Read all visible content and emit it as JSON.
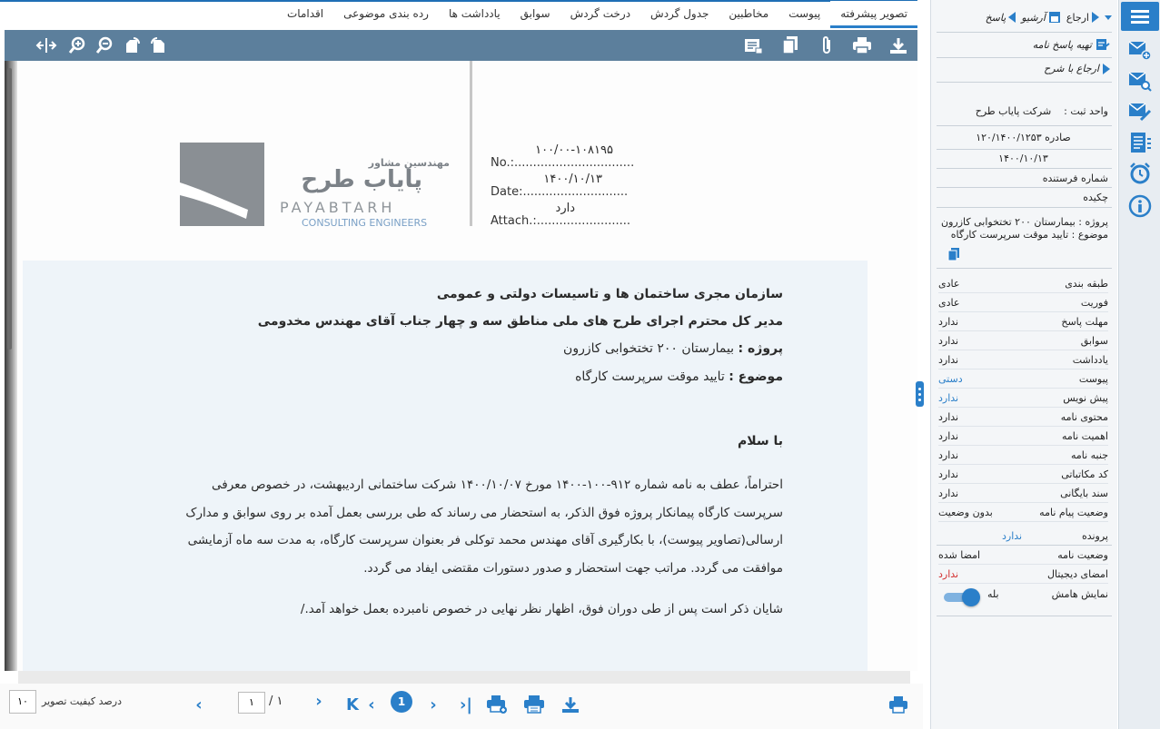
{
  "tabs": [
    "تصویر پیشرفته",
    "پیوست",
    "مخاطبین",
    "جدول گردش",
    "درخت گردش",
    "سوابق",
    "یادداشت ها",
    "رده بندی موضوعی",
    "اقدامات"
  ],
  "panel": {
    "actions": {
      "refer": "ارجاع",
      "archive": "آرشیو",
      "reply": "پاسخ"
    },
    "prepare_reply": "تهیه پاسخ نامه",
    "refer_with_note": "ارجاع با شرح",
    "register_unit_label": "واحد ثبت :",
    "register_unit_value": "شرکت پایاب طرح",
    "issued_label": "صادره",
    "issued_number": "۱۲۰/۱۴۰۰/۱۲۵۳",
    "issued_date": "۱۴۰۰/۱۰/۱۳",
    "sender_number_label": "شماره فرستنده",
    "summary_label": "چکیده",
    "summary_project": "پروژه : بیمارستان ۲۰۰ تختخوابی کازرون",
    "summary_subject": "موضوع : تایید موقت سرپرست کارگاه",
    "properties": [
      {
        "key": "طبقه بندی",
        "value": "عادی",
        "style": ""
      },
      {
        "key": "فوریت",
        "value": "عادی",
        "style": ""
      },
      {
        "key": "مهلت پاسخ",
        "value": "ندارد",
        "style": ""
      },
      {
        "key": "سوابق",
        "value": "ندارد",
        "style": ""
      },
      {
        "key": "یادداشت",
        "value": "ندارد",
        "style": ""
      },
      {
        "key": "پیوست",
        "value": "دستی",
        "style": "blue"
      },
      {
        "key": "پیش نویس",
        "value": "ندارد",
        "style": "blue"
      },
      {
        "key": "محتوی نامه",
        "value": "ندارد",
        "style": ""
      },
      {
        "key": "اهمیت نامه",
        "value": "ندارد",
        "style": ""
      },
      {
        "key": "جنبه نامه",
        "value": "ندارد",
        "style": ""
      },
      {
        "key": "کد مکاتباتی",
        "value": "ندارد",
        "style": ""
      },
      {
        "key": "سند بایگانی",
        "value": "ندارد",
        "style": ""
      },
      {
        "key": "وضعیت پیام نامه",
        "value": "بدون وضعیت",
        "style": ""
      }
    ],
    "file_label": "پرونده",
    "file_value": "ندارد",
    "letter_status_label": "وضعیت نامه",
    "letter_status_value": "امضا شده",
    "digital_signature_label": "امضای دیجیتال",
    "digital_signature_value": "ندارد",
    "show_margin_label": "نمایش هامش",
    "show_margin_value": "بله",
    "show_margin_on": true
  },
  "document": {
    "logo_persian_small": "مهندسین مشاور",
    "logo_persian_big": "پایاب طرح",
    "logo_latin": "PAYABTARH",
    "logo_latin_sub": "CONSULTING ENGINEERS",
    "no_value": "۱۰۰/۰۰-۱۰۸۱۹۵",
    "no_label": "No.:................................",
    "date_value": "۱۴۰۰/۱۰/۱۳",
    "date_label": "Date:............................",
    "attach_value": "دارد",
    "attach_label": "Attach.:.........................",
    "recipient_1": "سازمان مجری ساختمان ها و تاسیسات دولتی و عمومی",
    "recipient_2": "مدیر کل محترم اجرای طرح های ملی مناطق سه و چهار جناب آقای مهندس مخدومی",
    "project_label": "پروژه :",
    "project_value": "بیمارستان ۲۰۰ تختخوابی کازرون",
    "subject_label": "موضوع :",
    "subject_value": "تایید موقت سرپرست کارگاه",
    "greeting": "با سلام",
    "body_1": "احتراماً، عطف به نامه شماره ۹۱۲-۱۰۰-۱۴۰۰ مورخ ۱۴۰۰/۱۰/۰۷ شرکت ساختمانی اردیبهشت، در خصوص معرفی",
    "body_2": "سرپرست کارگاه پیمانکار پروژه فوق الذکر، به استحضار می رساند که طی بررسی بعمل آمده بر روی سوابق و مدارک",
    "body_3": "ارسالی(تصاویر پیوست)، با بکارگیری آقای مهندس محمد توکلی فر بعنوان سرپرست کارگاه، به مدت سه ماه آزمایشی",
    "body_4": "موافقت می گردد. مراتب جهت استحضار و صدور دستورات مقتضی ایفاد می گردد.",
    "body_5": "شایان ذکر است پس از طی دوران فوق، اظهار نظر نهایی در خصوص نامبرده بعمل خواهد آمد./"
  },
  "pager": {
    "current_page": "۱",
    "total_pages": "/ ۱",
    "page_badge": "1",
    "quality_label": "درصد کیفیت تصویر",
    "quality_value": "۱۰"
  },
  "colors": {
    "accent": "#2a7fc9",
    "toolbar": "#5c7f9c",
    "negative": "#d32f2f"
  }
}
